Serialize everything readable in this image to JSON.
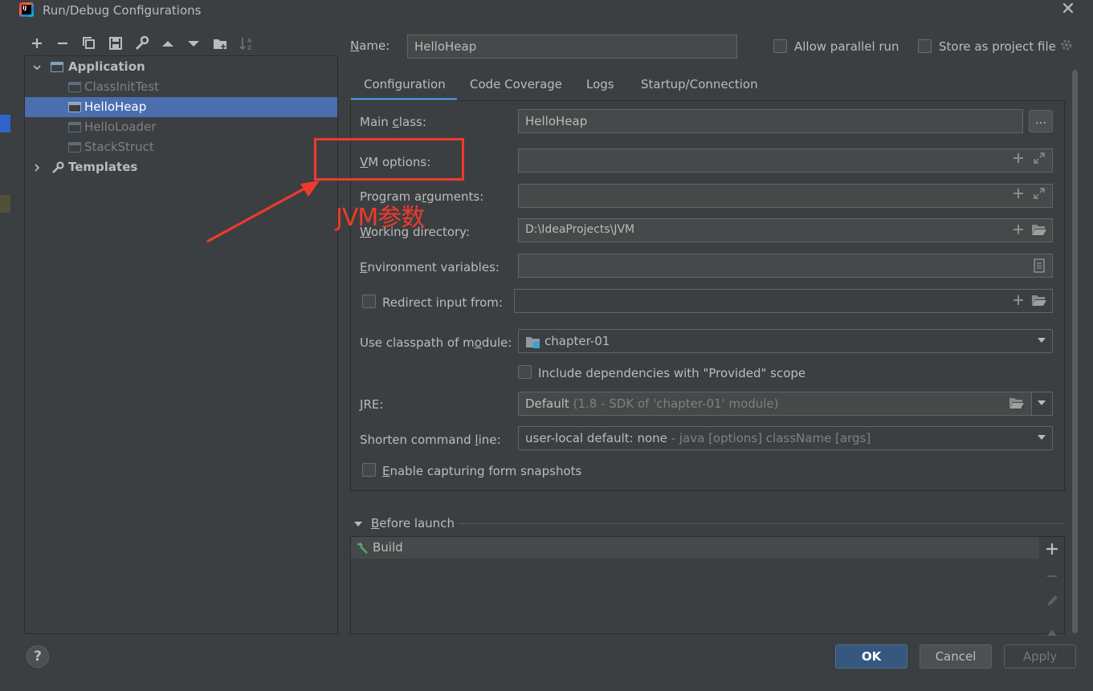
{
  "window": {
    "title": "Run/Debug Configurations",
    "app_icon_text": "IJ",
    "close_symbol": "✕"
  },
  "toolbar": {
    "icons": [
      "add-icon",
      "remove-icon",
      "copy-icon",
      "save-icon",
      "wrench-icon",
      "move-up-icon",
      "move-down-icon",
      "folder-icon",
      "sort-icon"
    ]
  },
  "tree": {
    "application": "Application",
    "items": [
      "ClassInitTest",
      "HelloHeap",
      "HelloLoader",
      "StackStruct"
    ],
    "selected": "HelloHeap",
    "templates": "Templates"
  },
  "header": {
    "name_label": "Name:",
    "name_value": "HelloHeap",
    "allow_parallel_label": "Allow parallel run",
    "store_label": "Store as project file"
  },
  "tabs": [
    "Configuration",
    "Code Coverage",
    "Logs",
    "Startup/Connection"
  ],
  "form": {
    "main_class_label": "Main class:",
    "main_class_value": "HelloHeap",
    "browse_button": "...",
    "vm_options_label": "VM options:",
    "program_args_label": "Program arguments:",
    "working_dir_label": "Working directory:",
    "working_dir_value": "D:\\IdeaProjects\\JVM",
    "env_vars_label": "Environment variables:",
    "redirect_label": "Redirect input from:",
    "classpath_label": "Use classpath of module:",
    "classpath_value": "chapter-01",
    "include_deps_label": "Include dependencies with \"Provided\" scope",
    "jre_label": "JRE:",
    "jre_value": "Default",
    "jre_hint": "(1.8 - SDK of 'chapter-01' module)",
    "shorten_label": "Shorten command line:",
    "shorten_value": "user-local default: none",
    "shorten_hint": "- java [options] className [args]",
    "capture_label": "Enable capturing form snapshots"
  },
  "before_launch": {
    "title": "Before launch",
    "items": [
      "Build"
    ]
  },
  "annotation": {
    "text": "JVM参数",
    "color": "#f03a2b"
  },
  "buttons": {
    "ok": "OK",
    "cancel": "Cancel",
    "apply": "Apply",
    "help": "?"
  },
  "colors": {
    "background": "#3c3f41",
    "selection": "#4b6eaf",
    "primary_button": "#365880",
    "tab_underline": "#4a88c7"
  }
}
